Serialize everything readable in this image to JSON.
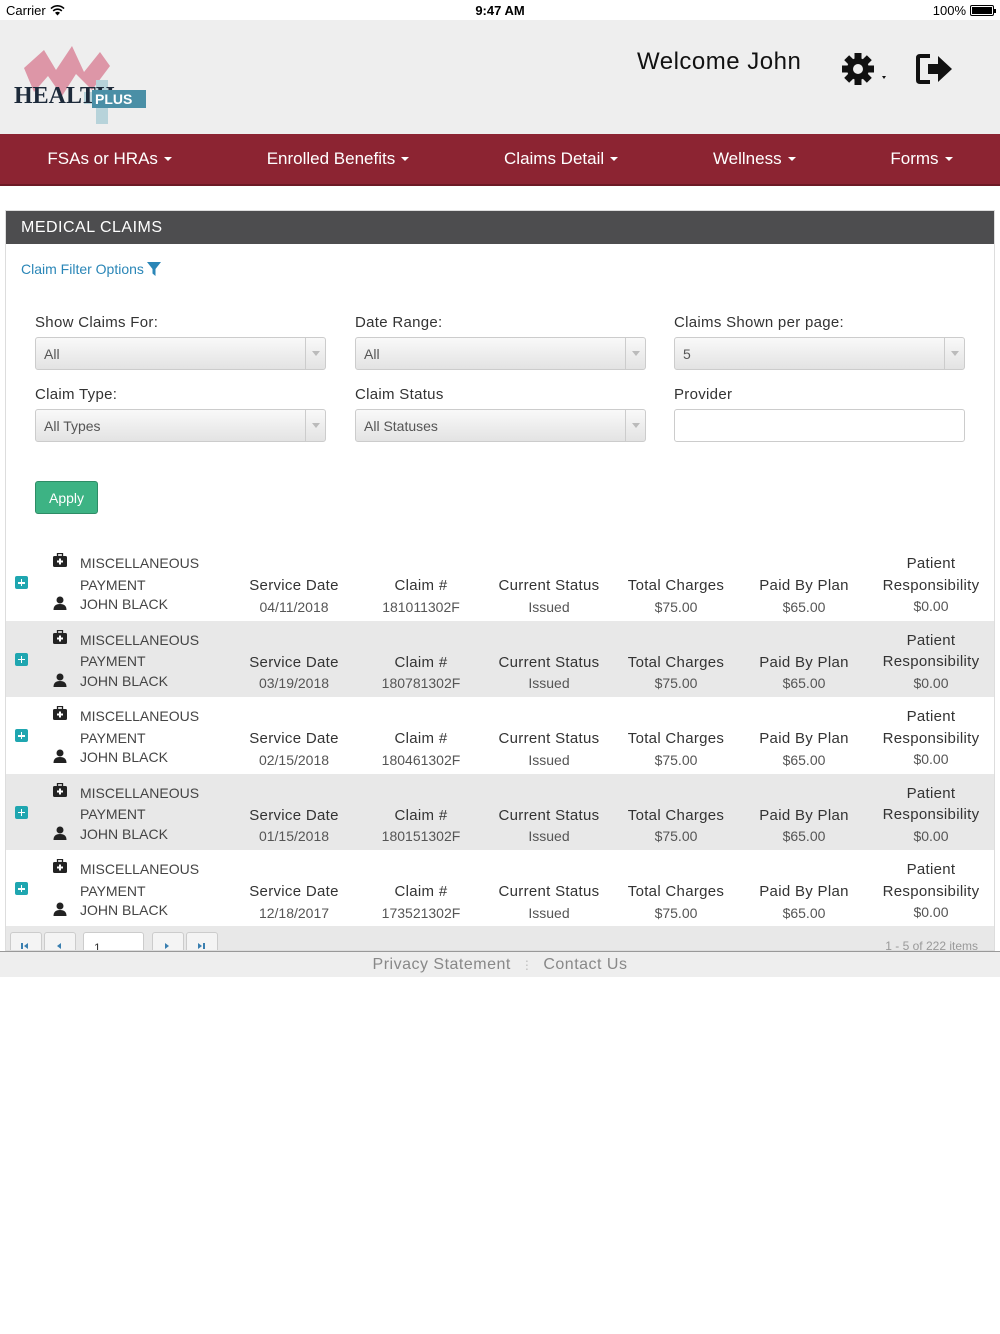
{
  "status_bar": {
    "carrier": "Carrier",
    "time": "9:47 AM",
    "battery": "100%"
  },
  "header": {
    "logo_text_main": "HEALTH",
    "logo_text_badge": "PLUS",
    "welcome": "Welcome John"
  },
  "nav": {
    "items": [
      {
        "label": "FSAs or HRAs"
      },
      {
        "label": "Enrolled Benefits"
      },
      {
        "label": "Claims Detail"
      },
      {
        "label": "Wellness"
      },
      {
        "label": "Forms"
      }
    ]
  },
  "panel": {
    "title": "MEDICAL CLAIMS",
    "filter_link": "Claim Filter Options",
    "filters": {
      "show_claims_for": {
        "label": "Show Claims For:",
        "value": "All"
      },
      "date_range": {
        "label": "Date Range:",
        "value": "All"
      },
      "per_page": {
        "label": "Claims Shown per page:",
        "value": "5"
      },
      "claim_type": {
        "label": "Claim Type:",
        "value": "All Types"
      },
      "claim_status": {
        "label": "Claim Status",
        "value": "All Statuses"
      },
      "provider": {
        "label": "Provider",
        "value": ""
      }
    },
    "apply_label": "Apply"
  },
  "columns": {
    "service_date": "Service Date",
    "claim_no": "Claim #",
    "status": "Current Status",
    "total": "Total Charges",
    "paid": "Paid By Plan",
    "patient_1": "Patient",
    "patient_2": "Responsibility"
  },
  "claims": [
    {
      "type_1": "MISCELLANEOUS",
      "type_2": "PAYMENT",
      "patient": "JOHN BLACK",
      "service_date": "04/11/2018",
      "claim_no": "181011302F",
      "status": "Issued",
      "total": "$75.00",
      "paid": "$65.00",
      "responsibility": "$0.00"
    },
    {
      "type_1": "MISCELLANEOUS",
      "type_2": "PAYMENT",
      "patient": "JOHN BLACK",
      "service_date": "03/19/2018",
      "claim_no": "180781302F",
      "status": "Issued",
      "total": "$75.00",
      "paid": "$65.00",
      "responsibility": "$0.00"
    },
    {
      "type_1": "MISCELLANEOUS",
      "type_2": "PAYMENT",
      "patient": "JOHN BLACK",
      "service_date": "02/15/2018",
      "claim_no": "180461302F",
      "status": "Issued",
      "total": "$75.00",
      "paid": "$65.00",
      "responsibility": "$0.00"
    },
    {
      "type_1": "MISCELLANEOUS",
      "type_2": "PAYMENT",
      "patient": "JOHN BLACK",
      "service_date": "01/15/2018",
      "claim_no": "180151302F",
      "status": "Issued",
      "total": "$75.00",
      "paid": "$65.00",
      "responsibility": "$0.00"
    },
    {
      "type_1": "MISCELLANEOUS",
      "type_2": "PAYMENT",
      "patient": "JOHN BLACK",
      "service_date": "12/18/2017",
      "claim_no": "173521302F",
      "status": "Issued",
      "total": "$75.00",
      "paid": "$65.00",
      "responsibility": "$0.00"
    }
  ],
  "pager": {
    "page": "1",
    "info": "1 - 5 of 222 items"
  },
  "footer": {
    "privacy": "Privacy Statement",
    "contact": "Contact Us"
  },
  "colors": {
    "nav_bg": "#8c2432",
    "panel_head": "#4d4d4f",
    "apply": "#3db384",
    "link": "#2a86b7",
    "expand": "#1fa6b0"
  },
  "icons": [
    "wifi-icon",
    "battery-icon",
    "gear-icon",
    "logout-icon",
    "filter-icon",
    "medical-kit-icon",
    "user-icon",
    "plus-square-icon"
  ]
}
